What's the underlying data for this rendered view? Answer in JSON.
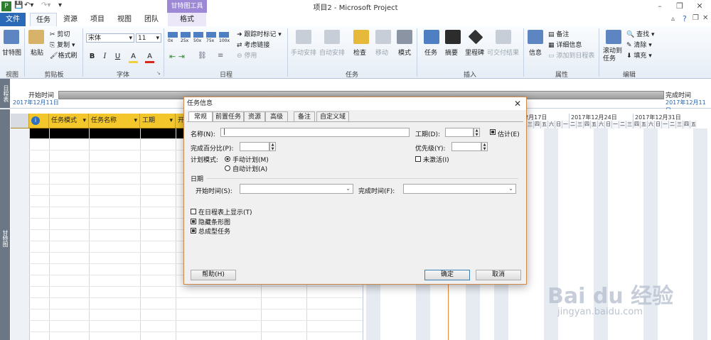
{
  "window": {
    "title": "项目2 - Microsoft Project",
    "context_group": "甘特图工具"
  },
  "tabs": [
    "文件",
    "任务",
    "资源",
    "项目",
    "视图",
    "团队",
    "格式"
  ],
  "ribbon": {
    "view": {
      "gantt_label": "甘特图",
      "group": "视图"
    },
    "clipboard": {
      "paste": "粘贴",
      "cut": "剪切",
      "copy": "复制",
      "format_painter": "格式刷",
      "group": "剪贴板"
    },
    "font": {
      "name": "宋体",
      "size": "11",
      "bold": "B",
      "italic": "I",
      "underline": "U",
      "fill_glyph": "A",
      "color_glyph": "A",
      "group": "字体"
    },
    "schedule": {
      "pct": [
        "0x",
        "25x",
        "50x",
        "75x",
        "100x"
      ],
      "track": "跟踪时标记",
      "respect_links": "考虑链接",
      "inactivate": "停用",
      "group": "日程"
    },
    "tasks": {
      "manual": "手动安排",
      "auto": "自动安排",
      "inspect": "检查",
      "move": "移动",
      "mode": "模式",
      "group": "任务"
    },
    "insert": {
      "task": "任务",
      "summary": "摘要",
      "milestone": "里程碑",
      "deliverable": "可交付结果",
      "group": "插入"
    },
    "properties": {
      "info": "信息",
      "notes": "备注",
      "details": "详细信息",
      "add_timeline": "添加到日程表",
      "group": "属性"
    },
    "editing": {
      "scroll_to_task": "滚动到任务",
      "find": "查找",
      "clear": "清除",
      "fill": "填充",
      "group": "编辑"
    }
  },
  "timeline": {
    "side_label": "日程表",
    "start_label": "开始时间",
    "start_date": "2017年12月11日",
    "finish_label": "完成时间",
    "finish_date": "2017年12月11日"
  },
  "view_side_label": "甘特图",
  "grid": {
    "headers": [
      "任务模式",
      "任务名称",
      "工期",
      "开"
    ]
  },
  "gantt": {
    "weeks": [
      "12月17日",
      "2017年12月24日",
      "2017年12月31日"
    ],
    "days": [
      "三",
      "四",
      "五",
      "六",
      "日",
      "一",
      "二",
      "三",
      "四",
      "五",
      "六",
      "日",
      "一",
      "二",
      "三",
      "四",
      "五",
      "六",
      "日",
      "一",
      "二",
      "三",
      "四",
      "五"
    ]
  },
  "dialog": {
    "title": "任务信息",
    "tabs": [
      "常规",
      "前置任务",
      "资源",
      "高级",
      "备注",
      "自定义域"
    ],
    "name_label": "名称(N):",
    "name_value": "|",
    "duration_label": "工期(D):",
    "estimated_label": "估计(E)",
    "pct_label": "完成百分比(P):",
    "priority_label": "优先级(Y):",
    "schedule_mode_label": "计划模式:",
    "manual_label": "手动计划(M)",
    "auto_label": "自动计划(A)",
    "inactive_label": "未激活(I)",
    "dates_heading": "日期",
    "start_label": "开始时间(S):",
    "finish_label": "完成时间(F):",
    "show_timeline": "在日程表上显示(T)",
    "hide_bar": "隐藏条形图",
    "rollup": "总成型任务",
    "help": "帮助(H)",
    "ok": "确定",
    "cancel": "取消"
  },
  "watermark": {
    "line1": "Bai du 经验",
    "line2": "jingyan.baidu.com"
  }
}
